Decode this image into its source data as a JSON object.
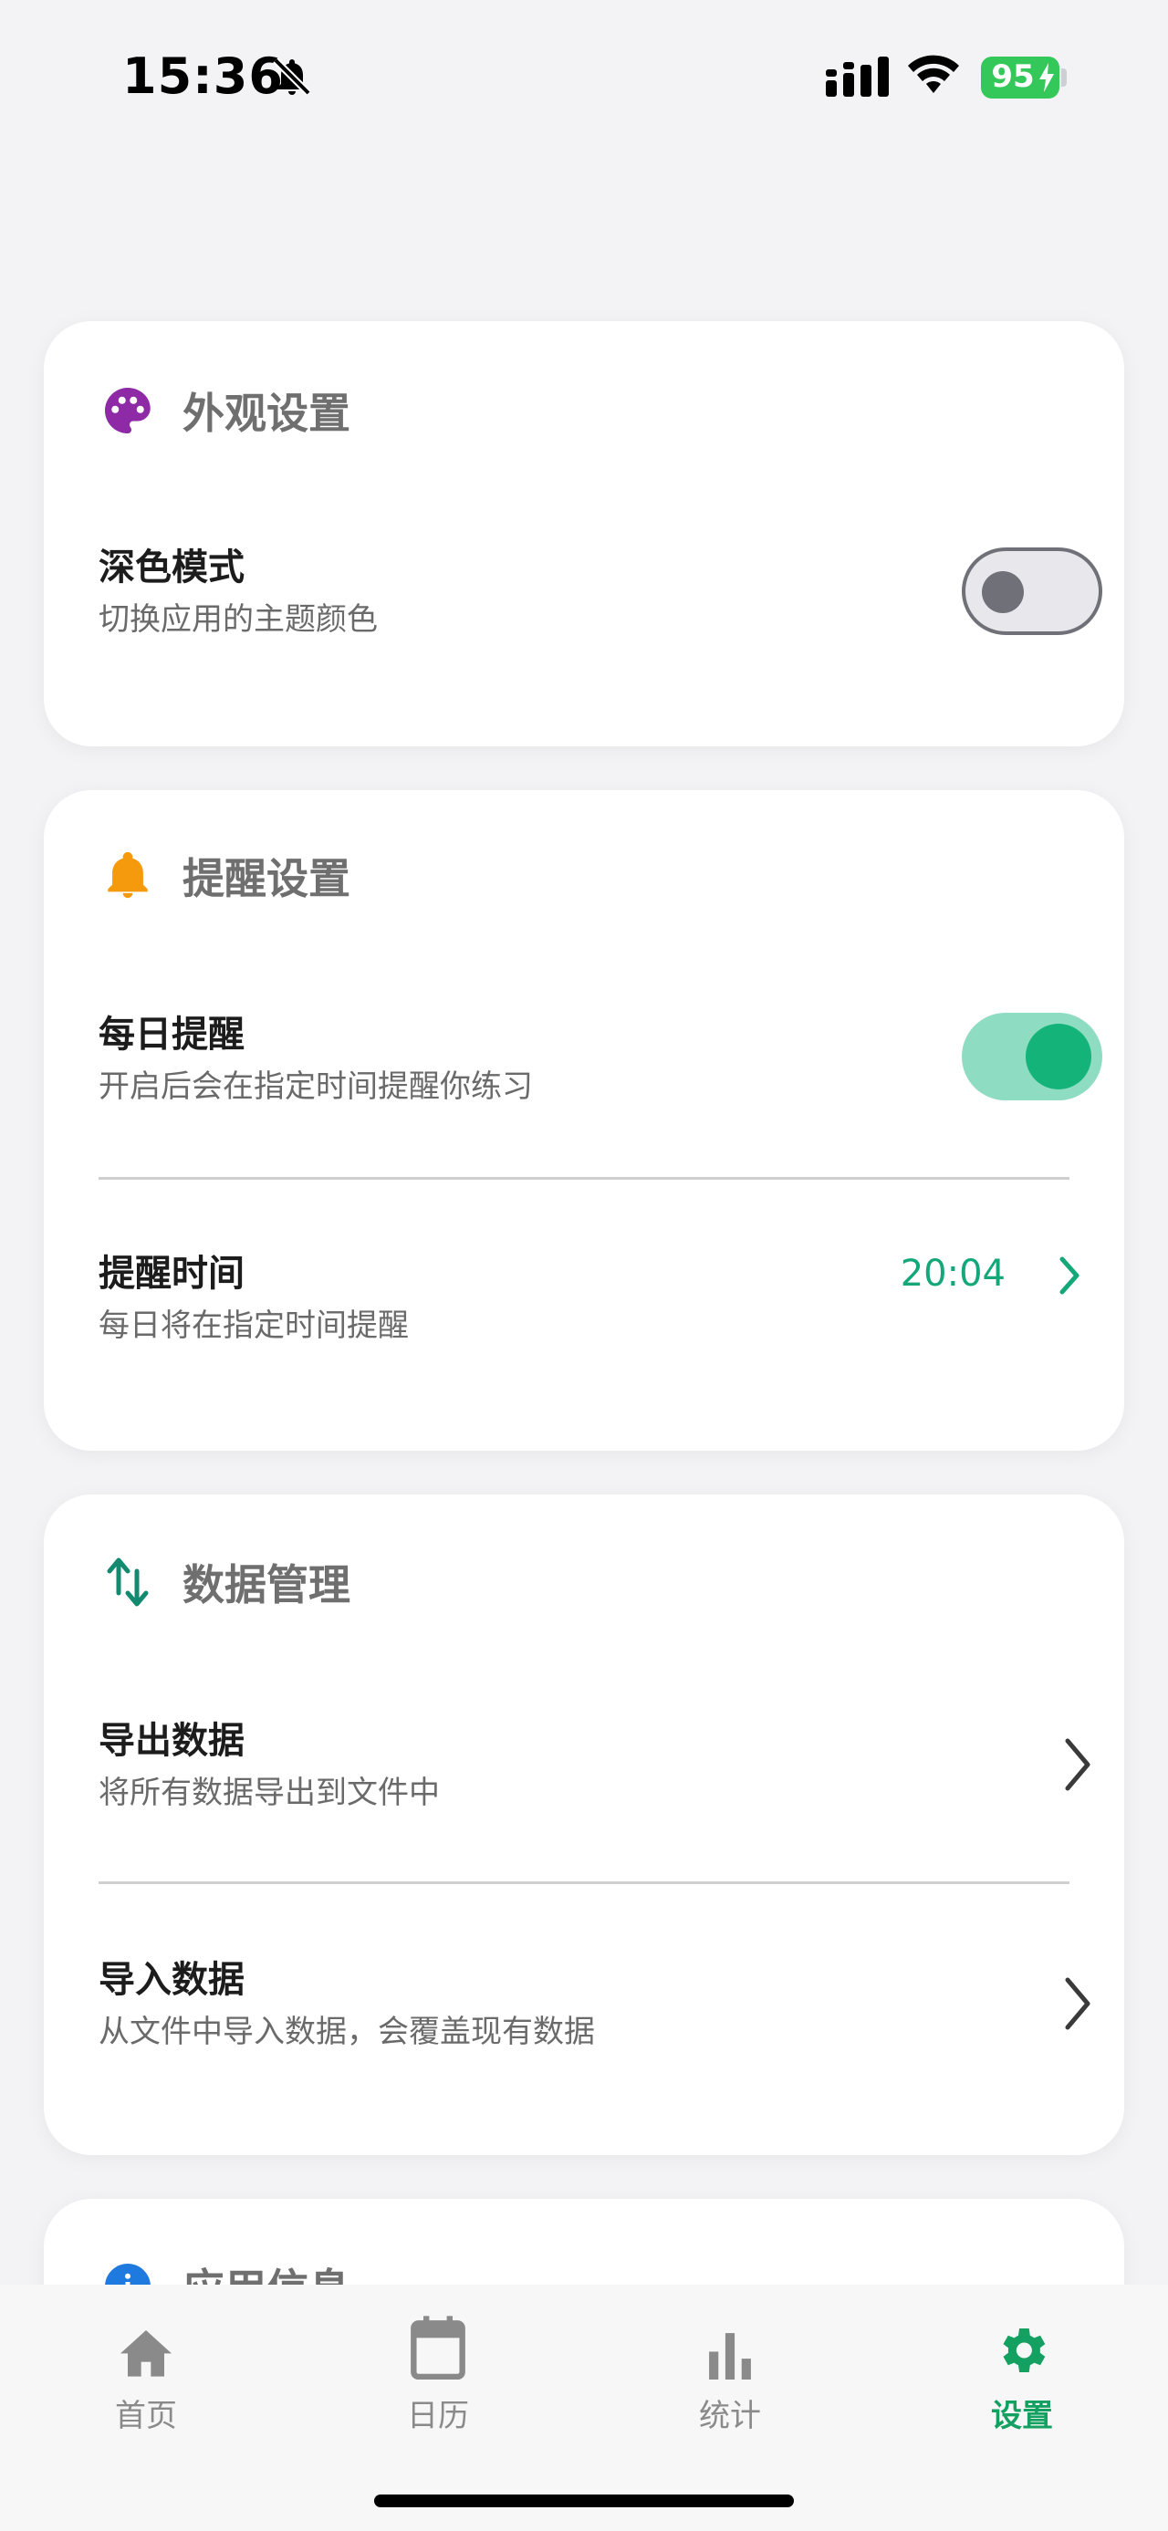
{
  "status_bar": {
    "time": "15:36",
    "battery": "95"
  },
  "sections": {
    "appearance": {
      "title": "外观设置",
      "dark_mode": {
        "title": "深色模式",
        "subtitle": "切换应用的主题颜色",
        "enabled": false
      }
    },
    "reminder": {
      "title": "提醒设置",
      "daily": {
        "title": "每日提醒",
        "subtitle": "开启后会在指定时间提醒你练习",
        "enabled": true
      },
      "time": {
        "title": "提醒时间",
        "subtitle": "每日将在指定时间提醒",
        "value": "20:04"
      }
    },
    "data": {
      "title": "数据管理",
      "export": {
        "title": "导出数据",
        "subtitle": "将所有数据导出到文件中"
      },
      "import": {
        "title": "导入数据",
        "subtitle": "从文件中导入数据，会覆盖现有数据"
      }
    },
    "app_info": {
      "title": "应用信息"
    }
  },
  "nav": {
    "items": [
      {
        "label": "首页",
        "icon": "home-icon"
      },
      {
        "label": "日历",
        "icon": "calendar-icon"
      },
      {
        "label": "统计",
        "icon": "bar-chart-icon"
      },
      {
        "label": "设置",
        "icon": "gear-icon",
        "active": true
      }
    ]
  },
  "colors": {
    "accent": "#14b37a",
    "active_nav": "#14a060",
    "palette_icon": "#8e2aa6",
    "bell_icon": "#f59a0c",
    "info_icon": "#1f7ae0"
  }
}
